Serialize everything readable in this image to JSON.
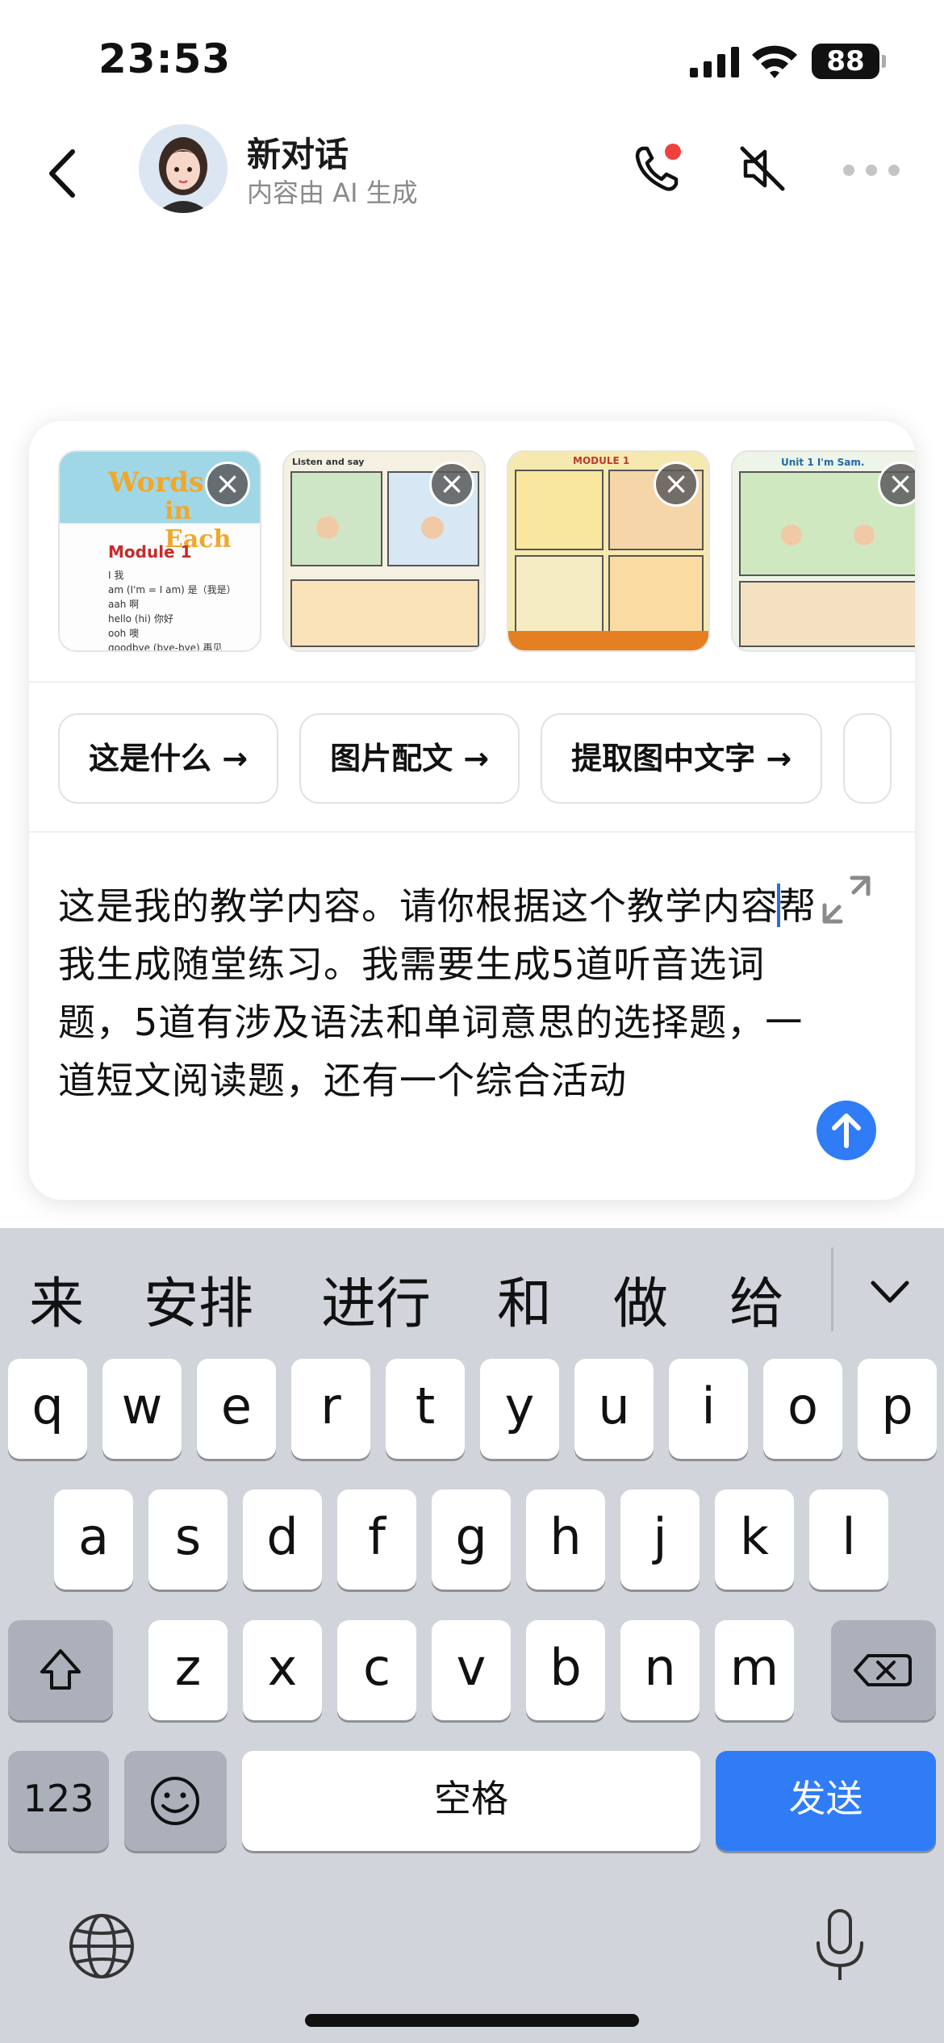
{
  "status_bar": {
    "time": "23:53",
    "battery": "88"
  },
  "header": {
    "title": "新对话",
    "subtitle": "内容由 AI 生成"
  },
  "attachments": [
    {
      "title_line1": "Words",
      "title_line2": "in Each",
      "module": "Module 1",
      "lines": [
        "I  我",
        "am (I'm = I am)  是（我是）",
        "aah  啊",
        "hello (hi)  你好",
        "ooh  噢",
        "goodbye (bye-bye)  再见"
      ]
    },
    {
      "label": "Listen and say"
    },
    {
      "label": "MODULE 1"
    },
    {
      "label": "Unit 1 I'm Sam."
    }
  ],
  "suggestions": [
    "这是什么 →",
    "图片配文 →",
    "提取图中文字 →"
  ],
  "prompt": {
    "before_cursor": "这是我的教学内容。请你根据这个教学内容",
    "after_cursor": "帮我生成随堂练习。我需要生成5道听音选词题，5道有涉及语法和单词意思的选择题，一道短文阅读题，还有一个综合活动"
  },
  "keyboard": {
    "candidates": [
      "来",
      "安排",
      "进行",
      "和",
      "做",
      "给"
    ],
    "row1": [
      "q",
      "w",
      "e",
      "r",
      "t",
      "y",
      "u",
      "i",
      "o",
      "p"
    ],
    "row2": [
      "a",
      "s",
      "d",
      "f",
      "g",
      "h",
      "j",
      "k",
      "l"
    ],
    "row3": [
      "z",
      "x",
      "c",
      "v",
      "b",
      "n",
      "m"
    ],
    "numbers_label": "123",
    "space_label": "空格",
    "send_label": "发送"
  },
  "colors": {
    "accent": "#2f7cf6",
    "keyboard_bg": "#d1d4da"
  }
}
